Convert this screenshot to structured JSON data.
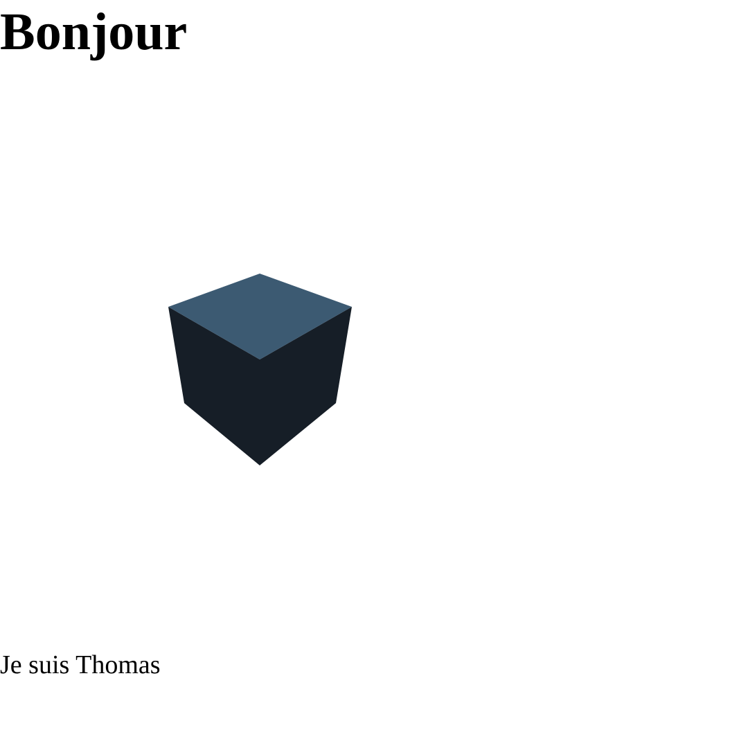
{
  "header": {
    "title": "Bonjour"
  },
  "scene": {
    "object": "cube",
    "colors": {
      "top_face": "#3c5a72",
      "side_faces": "#161e27",
      "background": "#ffffff"
    }
  },
  "footer": {
    "text": "Je suis Thomas"
  }
}
